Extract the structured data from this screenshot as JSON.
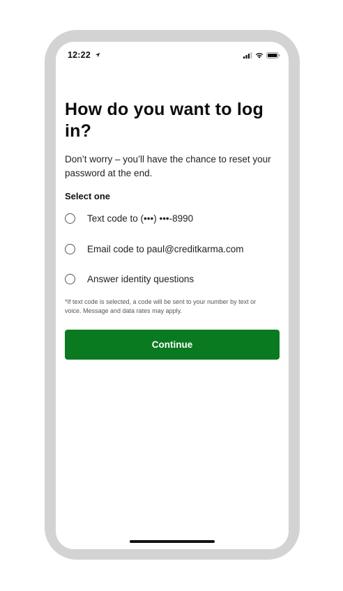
{
  "status_bar": {
    "time": "12:22",
    "location_icon": "location-arrow-icon",
    "signal_icon": "cellular-signal-icon",
    "wifi_icon": "wifi-icon",
    "battery_icon": "battery-icon"
  },
  "screen": {
    "title": "How do you want to log in?",
    "subtitle": "Don’t worry – you’ll have the chance to reset your password at the end.",
    "select_label": "Select one",
    "options": [
      {
        "label": "Text code to (•••) •••-8990",
        "selected": false
      },
      {
        "label": "Email code to paul@creditkarma.com",
        "selected": false
      },
      {
        "label": "Answer identity questions",
        "selected": false
      }
    ],
    "disclaimer": "*If text code is selected, a code will be sent to your number by text or voice. Message and data rates may apply.",
    "continue_label": "Continue"
  },
  "colors": {
    "primary_button": "#0a7a20",
    "phone_frame": "#d3d3d3"
  }
}
